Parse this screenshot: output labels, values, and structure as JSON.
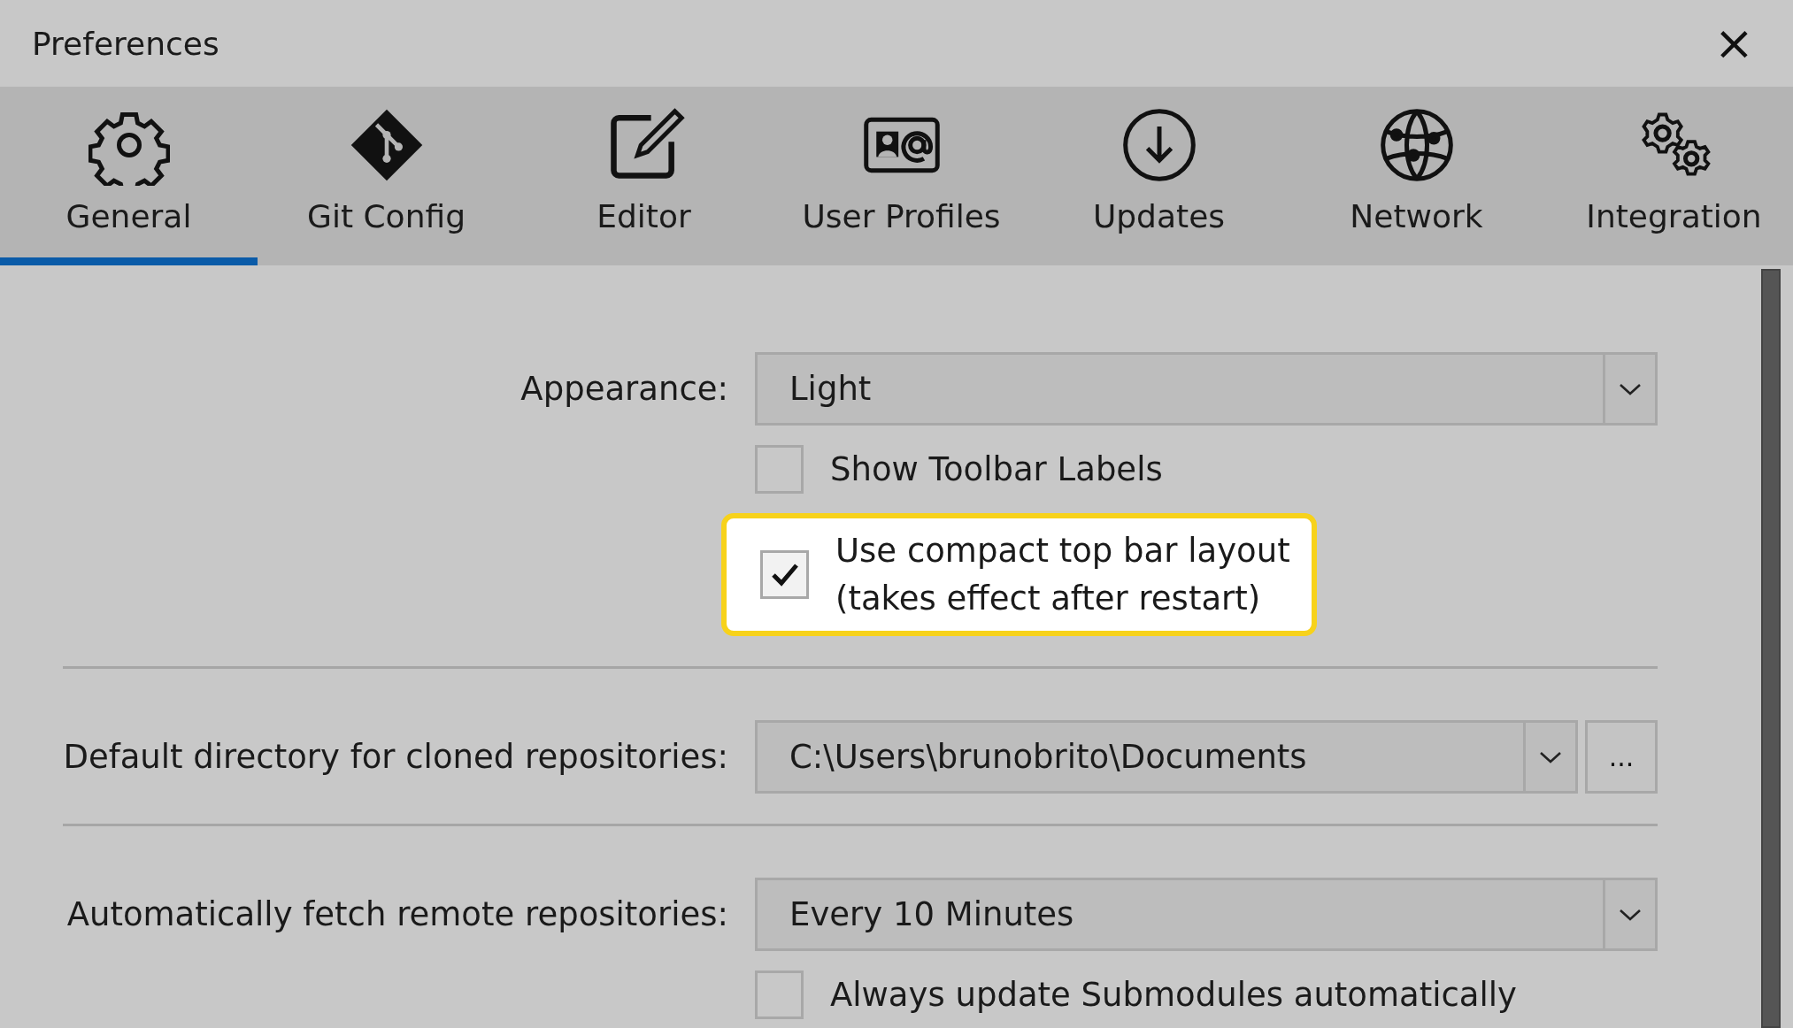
{
  "window": {
    "title": "Preferences",
    "close": "×"
  },
  "tabs": [
    {
      "label": "General",
      "selected": true
    },
    {
      "label": "Git Config",
      "selected": false
    },
    {
      "label": "Editor",
      "selected": false
    },
    {
      "label": "User Profiles",
      "selected": false
    },
    {
      "label": "Updates",
      "selected": false
    },
    {
      "label": "Network",
      "selected": false
    },
    {
      "label": "Integration",
      "selected": false
    }
  ],
  "sections": [
    {
      "rows": [
        {
          "kind": "select",
          "label": "Appearance:",
          "value": "Light"
        },
        {
          "kind": "checkbox",
          "text": "Show Toolbar Labels",
          "checked": false,
          "highlighted": false
        },
        {
          "kind": "checkbox",
          "text": "Use compact top bar layout\n(takes effect after restart)",
          "checked": true,
          "highlighted": true
        }
      ]
    },
    {
      "rows": [
        {
          "kind": "path",
          "label": "Default directory for cloned repositories:",
          "value": "C:\\Users\\brunobrito\\Documents",
          "browse": "..."
        }
      ]
    },
    {
      "rows": [
        {
          "kind": "select",
          "label": "Automatically fetch remote repositories:",
          "value": "Every 10 Minutes"
        },
        {
          "kind": "checkbox",
          "text": "Always update Submodules automatically",
          "checked": false,
          "highlighted": false
        }
      ]
    }
  ]
}
